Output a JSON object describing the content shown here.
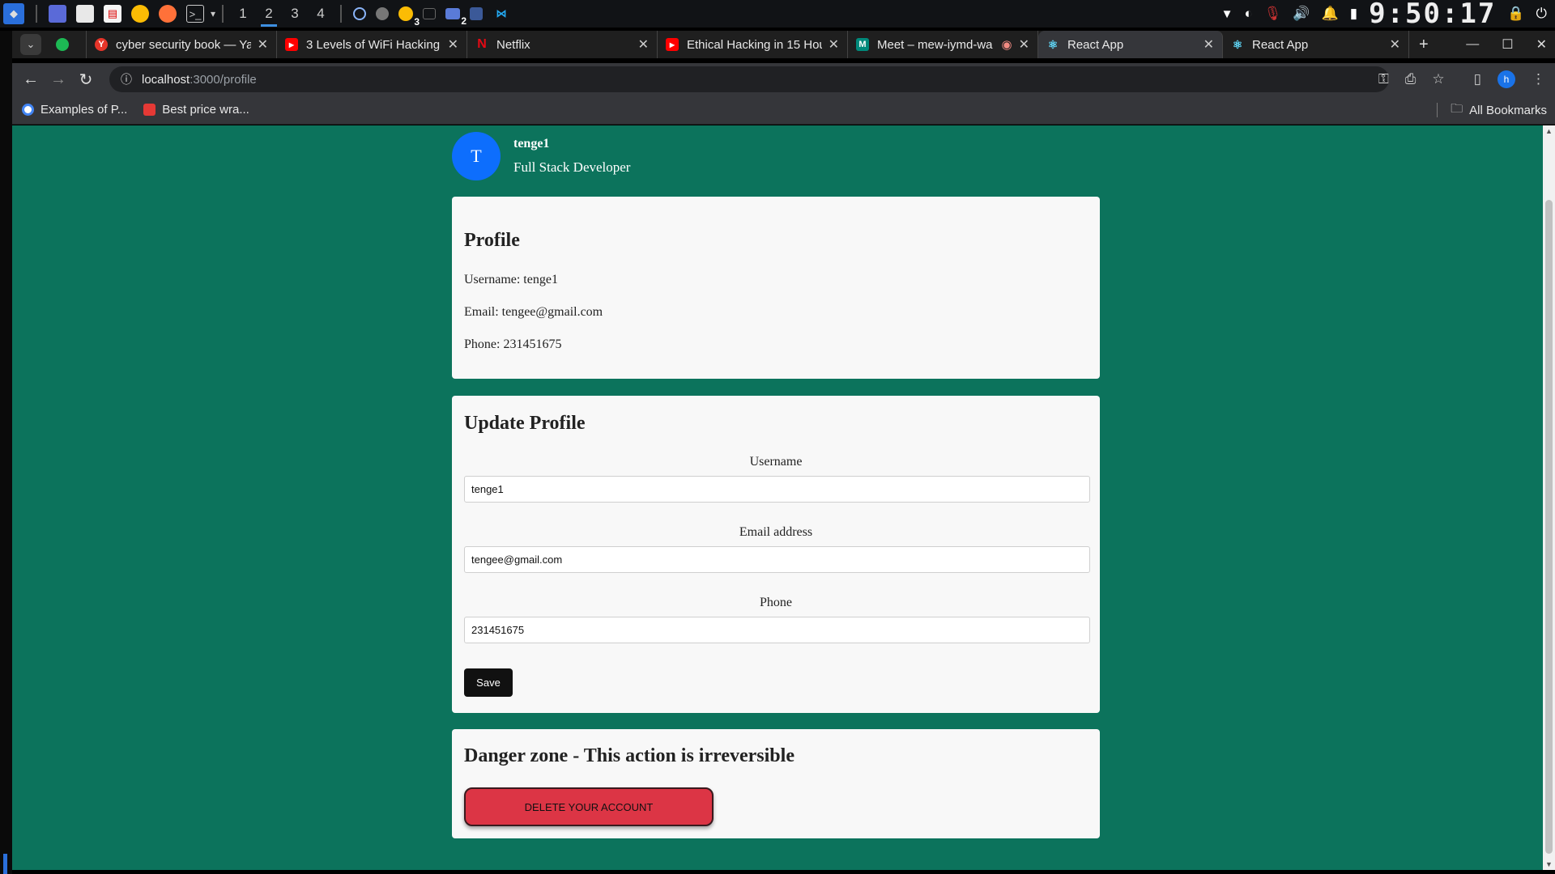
{
  "taskbar": {
    "workspaces": [
      "1",
      "2",
      "3",
      "4"
    ],
    "active_workspace": "2",
    "badges": {
      "chrome_windows": "3",
      "window_switcher": "2"
    },
    "clock": "9:50:17"
  },
  "tabs": [
    {
      "title": "cyber security book — Ya",
      "favicon": "yandex-icon",
      "color": "#e6352a",
      "fav_char": "Y"
    },
    {
      "title": "3 Levels of WiFi Hacking",
      "favicon": "youtube-icon",
      "color": "#ff0000",
      "fav_char": "▶"
    },
    {
      "title": "Netflix",
      "favicon": "netflix-icon",
      "color": "#e50914",
      "fav_char": "N"
    },
    {
      "title": "Ethical Hacking in 15 Hou",
      "favicon": "youtube-icon",
      "color": "#ff0000",
      "fav_char": "▶"
    },
    {
      "title": "Meet – mew-iymd-wa",
      "favicon": "meet-icon",
      "color": "#00897b",
      "fav_char": "M"
    },
    {
      "title": "React App",
      "favicon": "react-icon",
      "color": "#61dafb",
      "fav_char": "⚛",
      "active": true
    },
    {
      "title": "React App",
      "favicon": "react-icon",
      "color": "#61dafb",
      "fav_char": "⚛"
    }
  ],
  "address": {
    "host": "localhost",
    "path": ":3000/profile"
  },
  "account_initial": "h",
  "bookmarks": [
    {
      "label": "Examples of P...",
      "color": "#4285f4"
    },
    {
      "label": "Best price wra...",
      "color": "#e53935"
    }
  ],
  "all_bookmarks": "All Bookmarks",
  "user": {
    "initial": "T",
    "name": "tenge1",
    "role": "Full Stack Developer"
  },
  "profile": {
    "heading": "Profile",
    "username_line": "Username: tenge1",
    "email_line": "Email: tengee@gmail.com",
    "phone_line": "Phone: 231451675"
  },
  "update": {
    "heading": "Update Profile",
    "username_label": "Username",
    "username_value": "tenge1",
    "email_label": "Email address",
    "email_value": "tengee@gmail.com",
    "phone_label": "Phone",
    "phone_value": "231451675",
    "save_label": "Save"
  },
  "danger": {
    "heading": "Danger zone - This action is irreversible",
    "delete_label": "DELETE YOUR ACCOUNT"
  },
  "colors": {
    "page_bg": "#0c735c",
    "avatar": "#0d6efd",
    "danger": "#dc3545"
  }
}
